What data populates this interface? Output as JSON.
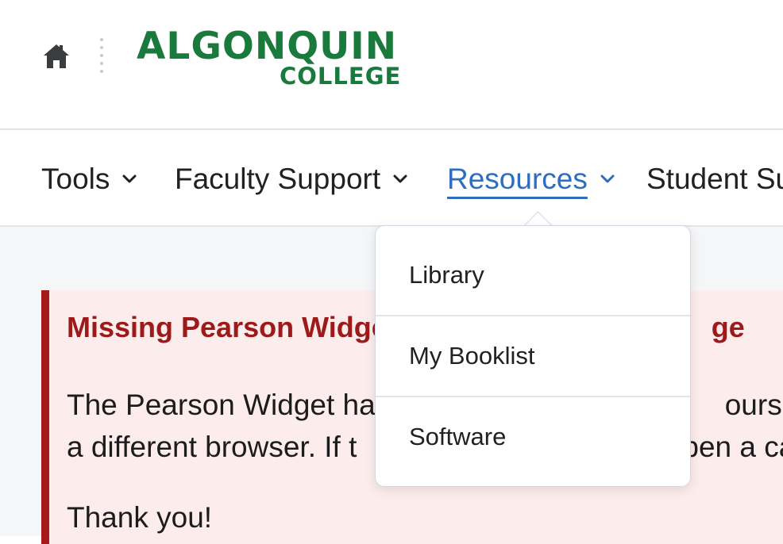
{
  "header": {
    "home_icon": "home-icon",
    "logo": {
      "line1": "ALGONQUIN",
      "line2": "COLLEGE",
      "color": "#1a7a3c"
    }
  },
  "nav": {
    "items": [
      {
        "label": "Tools",
        "active": false
      },
      {
        "label": "Faculty Support",
        "active": false
      },
      {
        "label": "Resources",
        "active": true
      },
      {
        "label": "Student Su",
        "active": false
      }
    ],
    "active_color": "#2e6dc0"
  },
  "dropdown": {
    "items": [
      {
        "label": "Library"
      },
      {
        "label": "My Booklist"
      },
      {
        "label": "Software"
      }
    ]
  },
  "alert": {
    "title": "Missing Pearson Widge",
    "title_tail": "ge",
    "body_line1_left": "The Pearson Widget ha",
    "body_line1_right": "ourses.",
    "body_line2_left": "a different browser. If t",
    "body_line2_right": "pen a ca",
    "thanks": "Thank you!",
    "accent_color": "#a6191c"
  }
}
